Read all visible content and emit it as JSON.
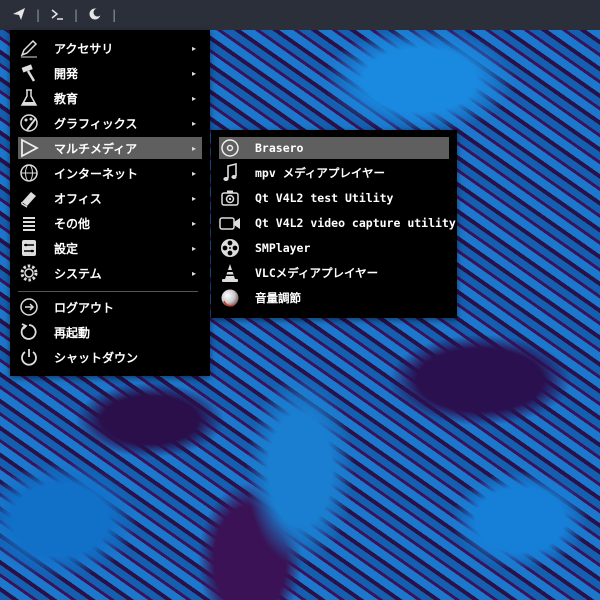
{
  "topbar": {
    "launcher_icon": "paper-plane-icon",
    "terminal_icon": "terminal-icon",
    "moon_icon": "moon-icon"
  },
  "main_menu": {
    "items": [
      {
        "label": "アクセサリ",
        "icon": "pen-icon",
        "has_submenu": true
      },
      {
        "label": "開発",
        "icon": "hammer-icon",
        "has_submenu": true
      },
      {
        "label": "教育",
        "icon": "flask-icon",
        "has_submenu": true
      },
      {
        "label": "グラフィックス",
        "icon": "palette-icon",
        "has_submenu": true
      },
      {
        "label": "マルチメディア",
        "icon": "play-icon",
        "has_submenu": true,
        "highlighted": true
      },
      {
        "label": "インターネット",
        "icon": "globe-icon",
        "has_submenu": true
      },
      {
        "label": "オフィス",
        "icon": "book-icon",
        "has_submenu": true
      },
      {
        "label": "その他",
        "icon": "list-icon",
        "has_submenu": true
      },
      {
        "label": "設定",
        "icon": "settings-icon",
        "has_submenu": true
      },
      {
        "label": "システム",
        "icon": "gear-icon",
        "has_submenu": true
      }
    ],
    "actions": [
      {
        "label": "ログアウト",
        "icon": "logout-icon"
      },
      {
        "label": "再起動",
        "icon": "restart-icon"
      },
      {
        "label": "シャットダウン",
        "icon": "power-icon"
      }
    ],
    "arrow": "▸"
  },
  "sub_menu": {
    "items": [
      {
        "label": "Brasero",
        "icon": "disc-icon",
        "highlighted": true
      },
      {
        "label": "mpv メディアプレイヤー",
        "icon": "music-note-icon"
      },
      {
        "label": "Qt V4L2 test Utility",
        "icon": "camera-icon"
      },
      {
        "label": "Qt V4L2 video capture utility",
        "icon": "video-camera-icon"
      },
      {
        "label": "SMPlayer",
        "icon": "film-reel-icon"
      },
      {
        "label": "VLCメディアプレイヤー",
        "icon": "vlc-cone-icon"
      },
      {
        "label": "音量調節",
        "icon": "volume-icon"
      }
    ]
  },
  "colors": {
    "menu_bg": "#000000",
    "highlight": "#5f5f5f",
    "topbar_bg": "#2a2f3a"
  }
}
